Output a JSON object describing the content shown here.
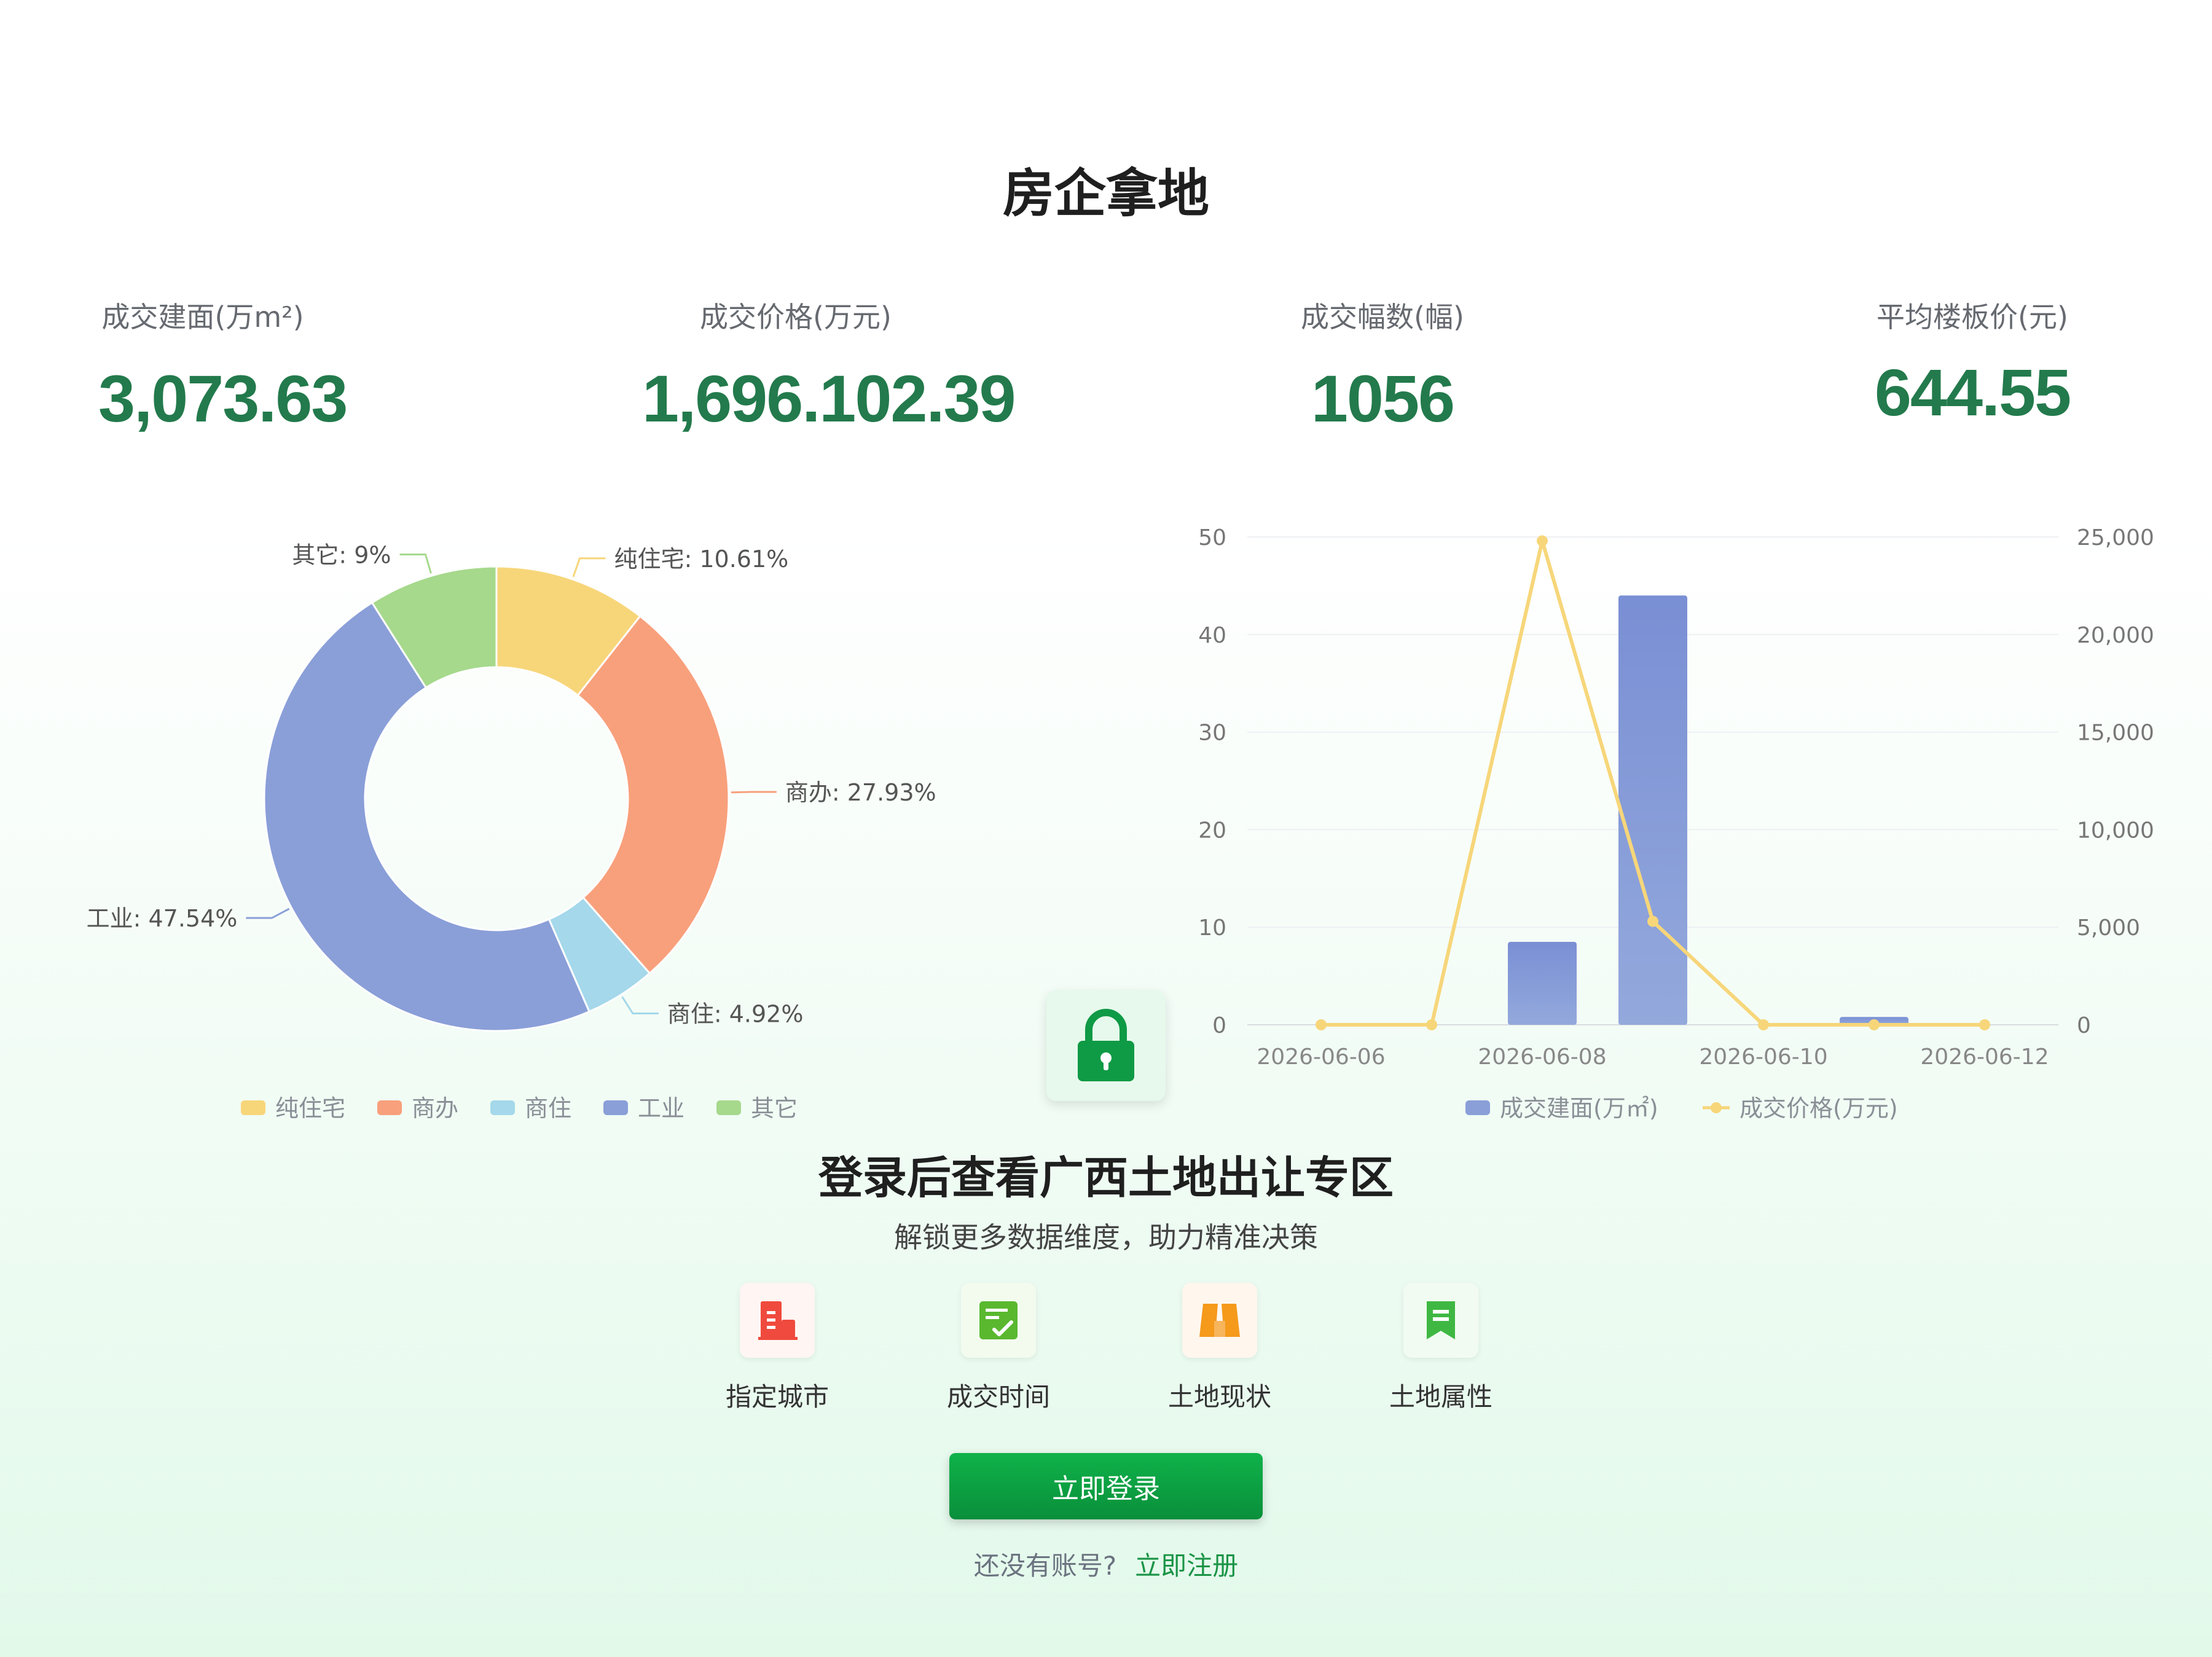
{
  "page": {
    "title": "房企拿地"
  },
  "stats": [
    {
      "label": "成交建面(万m²)",
      "value": "3,073.63"
    },
    {
      "label": "成交价格(万元)",
      "value": "1,696.102.39"
    },
    {
      "label": "成交幅数(幅)",
      "value": "1056"
    },
    {
      "label": "平均楼板价(元)",
      "value": "644.55"
    }
  ],
  "chart_data": [
    {
      "type": "pie",
      "variant": "donut",
      "labels": [
        "纯住宅",
        "商办",
        "商住",
        "工业",
        "其它"
      ],
      "values": [
        10.61,
        27.93,
        4.92,
        47.54,
        9
      ],
      "slice_labels": [
        "纯住宅: 10.61%",
        "商办: 27.93%",
        "商住: 4.92%",
        "工业: 47.54%",
        "其它: 9%"
      ],
      "colors": [
        "#f7d67a",
        "#f8a07c",
        "#a4d8ea",
        "#8a9fd8",
        "#a6d98c"
      ],
      "legend": [
        "纯住宅",
        "商办",
        "商住",
        "工业",
        "其它"
      ],
      "legend_position": "bottom"
    },
    {
      "type": "bar",
      "combo": "bar-line",
      "x": [
        "2026-06-06",
        "2026-06-07",
        "2026-06-08",
        "2026-06-09",
        "2026-06-10",
        "2026-06-11",
        "2026-06-12"
      ],
      "x_tick_labels": [
        "2026-06-06",
        "2026-06-08",
        "2026-06-10",
        "2026-06-12"
      ],
      "series": [
        {
          "name": "成交建面(万㎡)",
          "type": "bar",
          "axis": "left",
          "color": "#8a9fd8",
          "values": [
            0,
            0,
            8.5,
            44,
            0,
            0.8,
            0
          ]
        },
        {
          "name": "成交价格(万元)",
          "type": "line",
          "axis": "right",
          "color": "#f7d67a",
          "values": [
            0,
            0,
            24800,
            5300,
            0,
            0,
            0
          ]
        }
      ],
      "ylim": [
        0,
        50
      ],
      "y_ticks": [
        "0",
        "10",
        "20",
        "30",
        "40",
        "50"
      ],
      "y2lim": [
        0,
        25000
      ],
      "y2_ticks": [
        "0",
        "5,000",
        "10,000",
        "15,000",
        "20,000",
        "25,000"
      ],
      "grid": true,
      "legend_position": "bottom"
    }
  ],
  "login": {
    "title": "登录后查看广西土地出让专区",
    "subtitle": "解锁更多数据维度，助力精准决策",
    "features": [
      {
        "label": "指定城市",
        "icon": "building-icon",
        "color": "#f04a3e"
      },
      {
        "label": "成交时间",
        "icon": "calendar-check-icon",
        "color": "#5ab82f"
      },
      {
        "label": "土地现状",
        "icon": "map-icon",
        "color": "#f59a1b"
      },
      {
        "label": "土地属性",
        "icon": "bookmark-icon",
        "color": "#3fb843"
      }
    ],
    "button": "立即登录",
    "no_account": "还没有账号?",
    "register": "立即注册"
  }
}
